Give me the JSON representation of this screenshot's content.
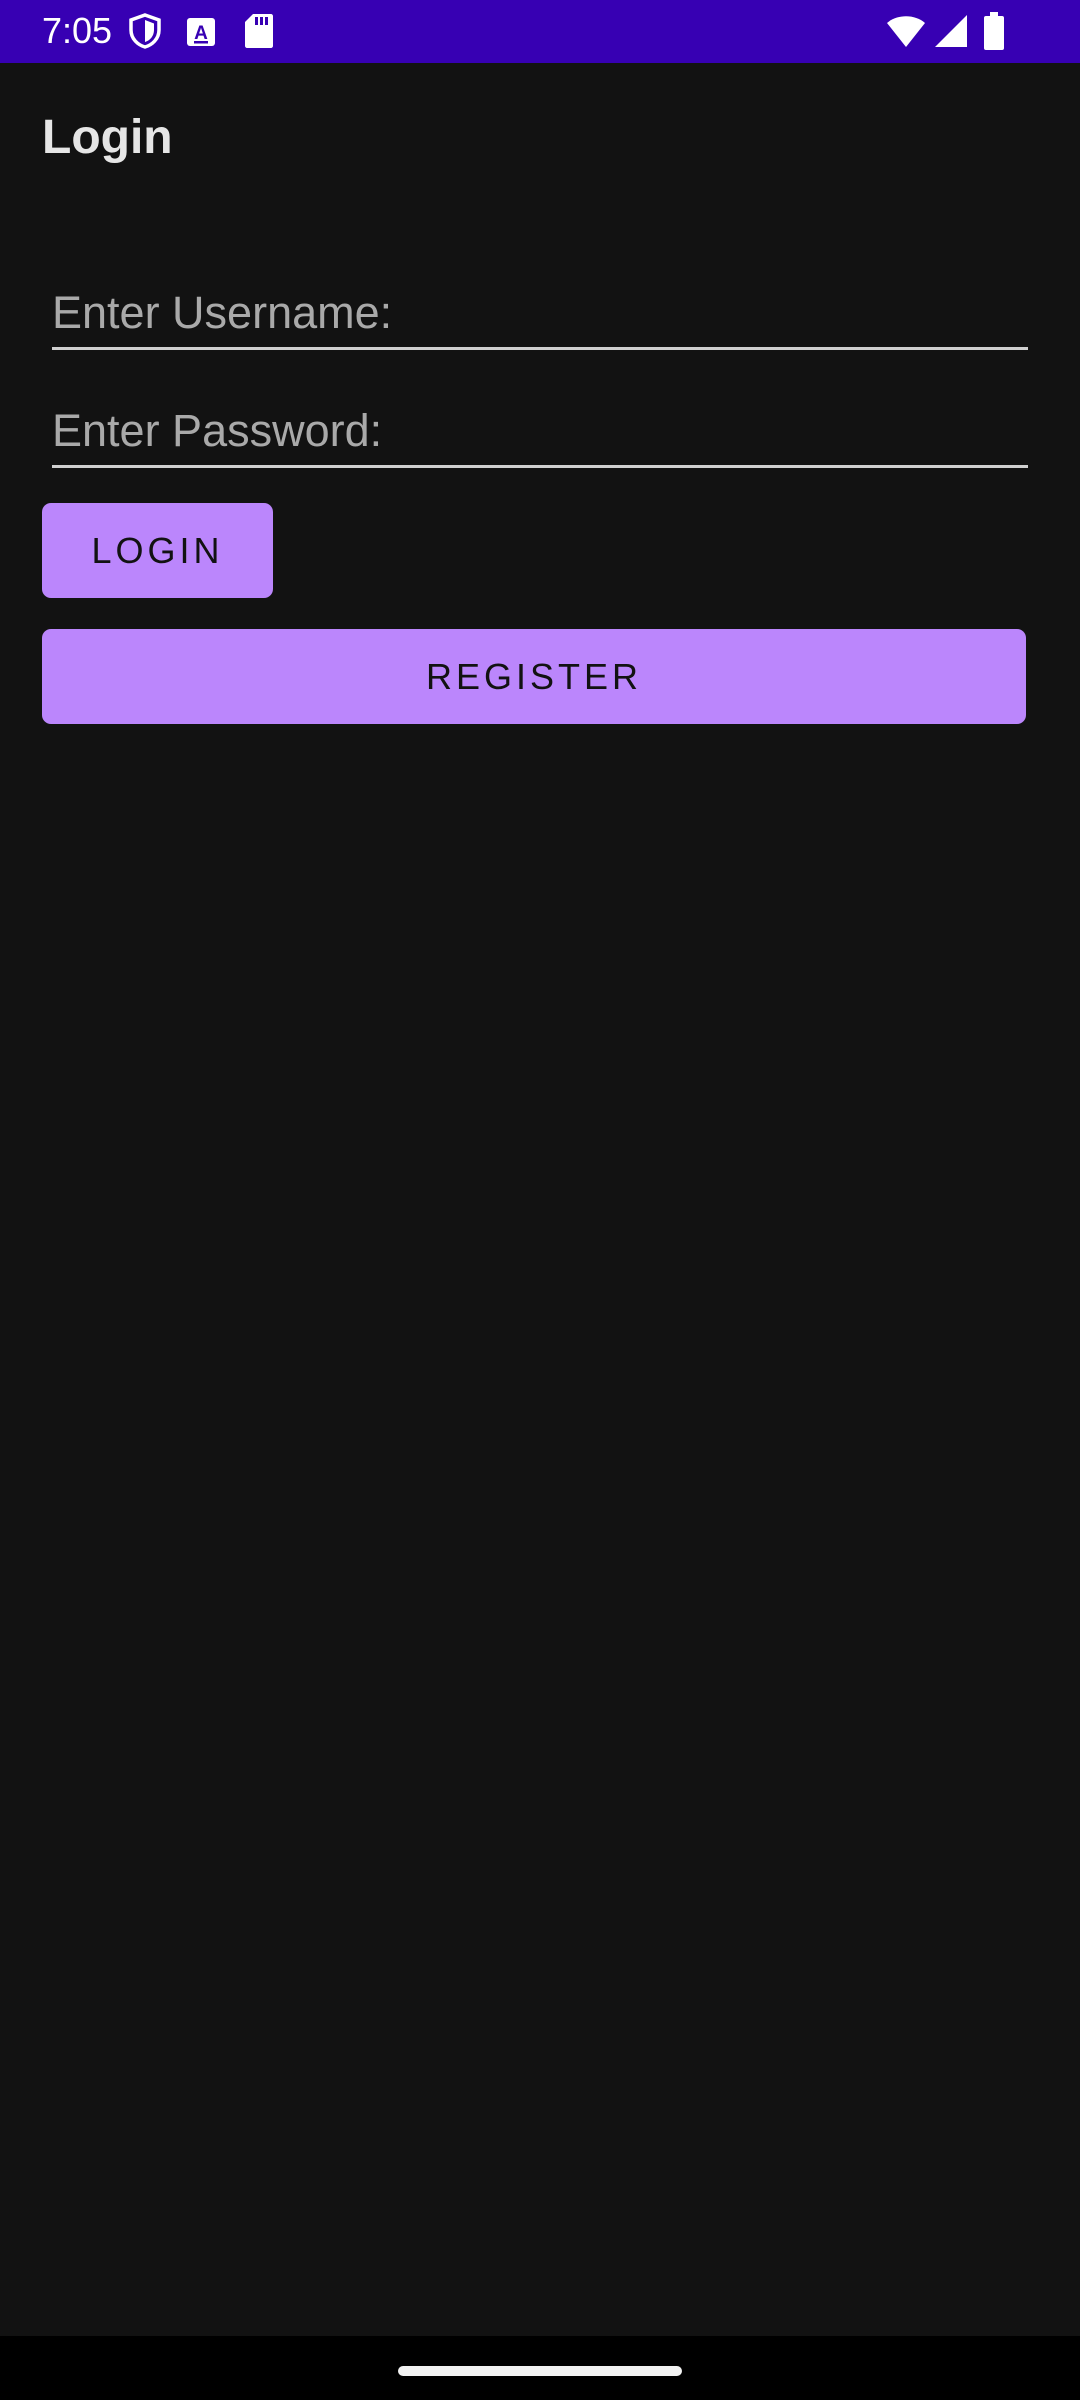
{
  "status_bar": {
    "time": "7:05",
    "icons": [
      "shield-icon",
      "text-a-icon",
      "sd-card-icon",
      "wifi-icon",
      "cell-signal-icon",
      "battery-icon"
    ],
    "background": "#3700b3"
  },
  "app": {
    "title": "Login"
  },
  "form": {
    "username": {
      "placeholder": "Enter Username:",
      "value": ""
    },
    "password": {
      "placeholder": "Enter Password:",
      "value": ""
    },
    "login_label": "Login",
    "register_label": "Register"
  },
  "theme": {
    "background": "#121212",
    "accent": "#bb86fc"
  },
  "nav_bar": {
    "handle": "home-handle"
  }
}
